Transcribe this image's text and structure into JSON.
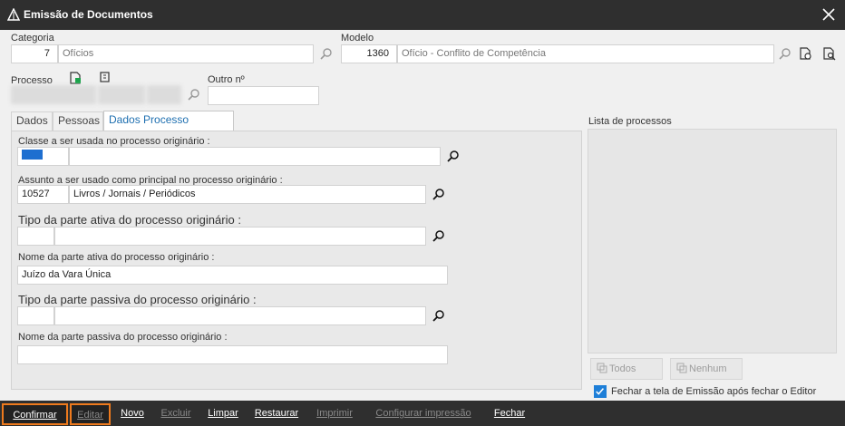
{
  "window": {
    "title": "Emissão de Documentos"
  },
  "header": {
    "categoria_label": "Categoria",
    "categoria_code": "7",
    "categoria_name": "Ofícios",
    "modelo_label": "Modelo",
    "modelo_code": "1360",
    "modelo_name": "Ofício - Conflito de Competência",
    "processo_label": "Processo",
    "outro_label": "Outro nº"
  },
  "tabs": [
    "Dados",
    "Pessoas",
    "Dados Processo Originário"
  ],
  "form": {
    "classe_label": "Classe a ser usada no processo originário :",
    "assunto_label": "Assunto a ser usado como principal no processo originário :",
    "assunto_code": "10527",
    "assunto_name": "Livros / Jornais / Periódicos",
    "tipo_ativa_label": "Tipo da parte ativa do processo originário :",
    "nome_ativa_label": "Nome da parte ativa do processo originário :",
    "nome_ativa_value": "Juízo da Vara Única",
    "tipo_passiva_label": "Tipo da parte passiva do processo originário :",
    "nome_passiva_label": "Nome da parte passiva do processo originário :"
  },
  "right": {
    "lista_label": "Lista de processos",
    "todos_label": "Todos",
    "nenhum_label": "Nenhum",
    "fechar_check_label": "Fechar a tela de Emissão após fechar o Editor"
  },
  "toolbar": {
    "confirmar": "Confirmar",
    "editar": "Editar",
    "novo": "Novo",
    "excluir": "Excluir",
    "limpar": "Limpar",
    "restaurar": "Restaurar",
    "imprimir": "Imprimir",
    "configurar": "Configurar impressão",
    "fechar": "Fechar"
  },
  "colors": {
    "accent": "#1e6fb0",
    "highlight": "#ee7a1d",
    "titlebar": "#2f2f2f"
  }
}
